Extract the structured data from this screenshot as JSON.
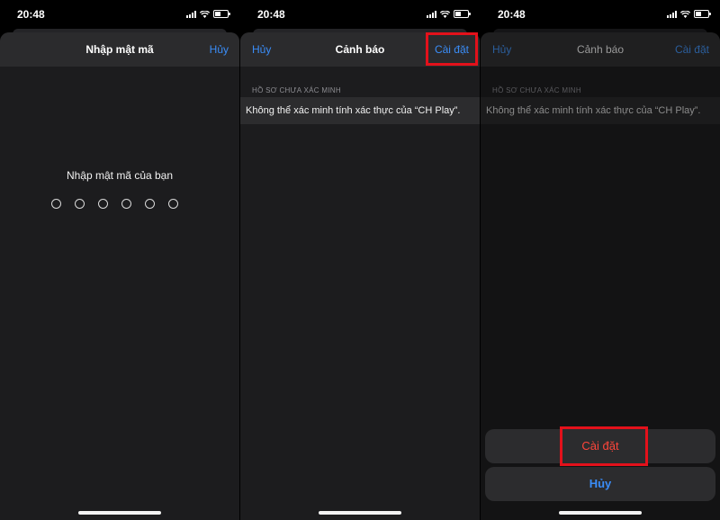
{
  "status_bar": {
    "time": "20:48"
  },
  "screen1": {
    "nav": {
      "title": "Nhập mật mã",
      "right": "Hủy"
    },
    "prompt": "Nhập mật mã của bạn",
    "passcode_length": 6
  },
  "screen2": {
    "nav": {
      "left": "Hủy",
      "title": "Cảnh báo",
      "right": "Cài đặt"
    },
    "section_header": "HỒ SƠ CHƯA XÁC MINH",
    "message": "Không thể xác minh tính xác thực của “CH Play”."
  },
  "screen3": {
    "nav": {
      "left": "Hủy",
      "title": "Cảnh báo",
      "right": "Cài đặt"
    },
    "section_header": "HỒ SƠ CHƯA XÁC MINH",
    "message": "Không thể xác minh tính xác thực của “CH Play”.",
    "actions": {
      "install": "Cài đặt",
      "cancel": "Hủy"
    }
  },
  "colors": {
    "accent": "#3a8df8",
    "destructive": "#ff453a",
    "highlight": "#e3111b"
  }
}
